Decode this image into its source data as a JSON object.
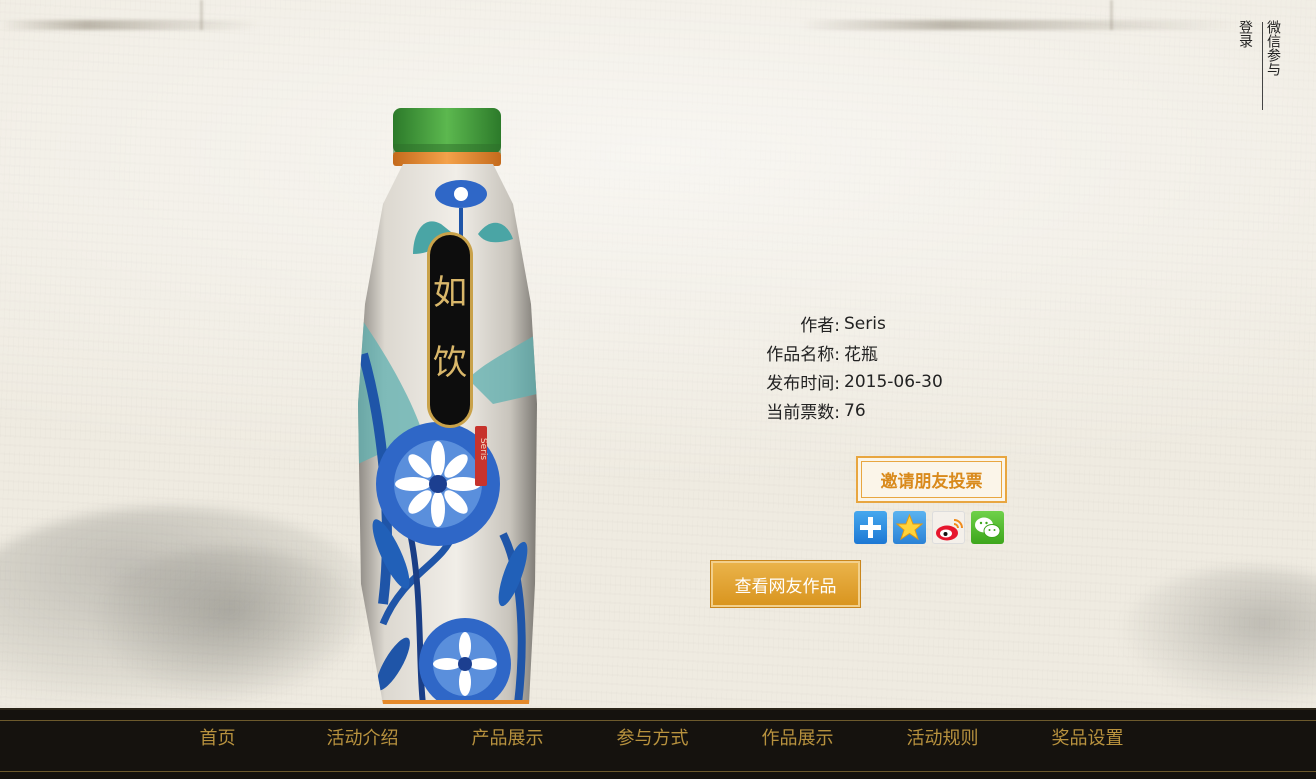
{
  "header": {
    "login_label": "登录",
    "wechat_label": "微信参与"
  },
  "product": {
    "brand_text": "如饮",
    "artist_seal": "Seris",
    "colors": {
      "cap": "#3f9a3a",
      "ring": "#e58a2a",
      "flower": "#2f67c7",
      "leaf": "#1f55a8"
    }
  },
  "info": {
    "author_label": "作者:",
    "author_value": "Seris",
    "title_label": "作品名称:",
    "title_value": "花瓶",
    "date_label": "发布时间:",
    "date_value": "2015-06-30",
    "votes_label": "当前票数:",
    "votes_value": "76"
  },
  "actions": {
    "invite_label": "邀请朋友投票",
    "view_label": "查看网友作品",
    "share_icons": [
      "more-share-icon",
      "qzone-icon",
      "weibo-icon",
      "wechat-icon"
    ]
  },
  "nav": {
    "items": [
      "首页",
      "活动介绍",
      "产品展示",
      "参与方式",
      "作品展示",
      "活动规则",
      "奖品设置"
    ]
  }
}
